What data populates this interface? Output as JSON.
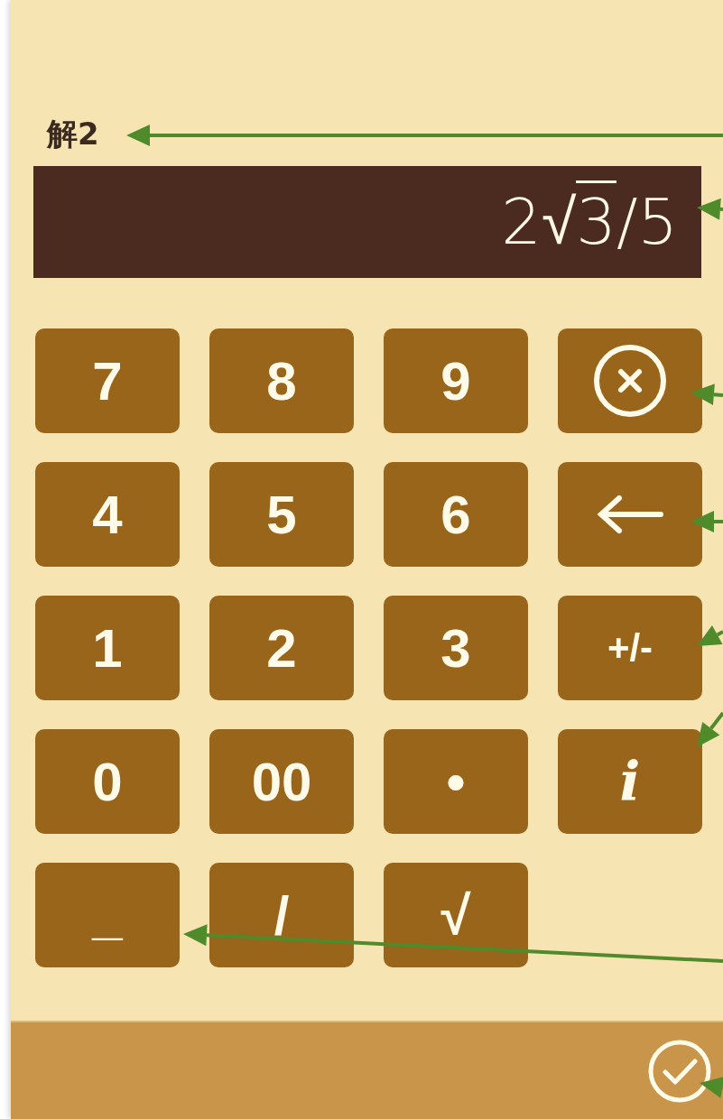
{
  "label": "解2",
  "display": {
    "parts": [
      {
        "kind": "plain",
        "text": "2"
      },
      {
        "kind": "root",
        "sign": "√",
        "radicand": "3"
      },
      {
        "kind": "plain",
        "text": "/5"
      }
    ]
  },
  "keys": [
    {
      "kind": "text",
      "label": "7"
    },
    {
      "kind": "text",
      "label": "8"
    },
    {
      "kind": "text",
      "label": "9"
    },
    {
      "kind": "clear"
    },
    {
      "kind": "text",
      "label": "4"
    },
    {
      "kind": "text",
      "label": "5"
    },
    {
      "kind": "text",
      "label": "6"
    },
    {
      "kind": "backspace"
    },
    {
      "kind": "text",
      "label": "1"
    },
    {
      "kind": "text",
      "label": "2"
    },
    {
      "kind": "text",
      "label": "3"
    },
    {
      "kind": "text",
      "label": "+/-"
    },
    {
      "kind": "text",
      "label": "0"
    },
    {
      "kind": "text",
      "label": "00"
    },
    {
      "kind": "text",
      "label": "•"
    },
    {
      "kind": "italic",
      "label": "i"
    },
    {
      "kind": "text",
      "label": "_"
    },
    {
      "kind": "text",
      "label": "/"
    },
    {
      "kind": "text",
      "label": "√"
    }
  ]
}
